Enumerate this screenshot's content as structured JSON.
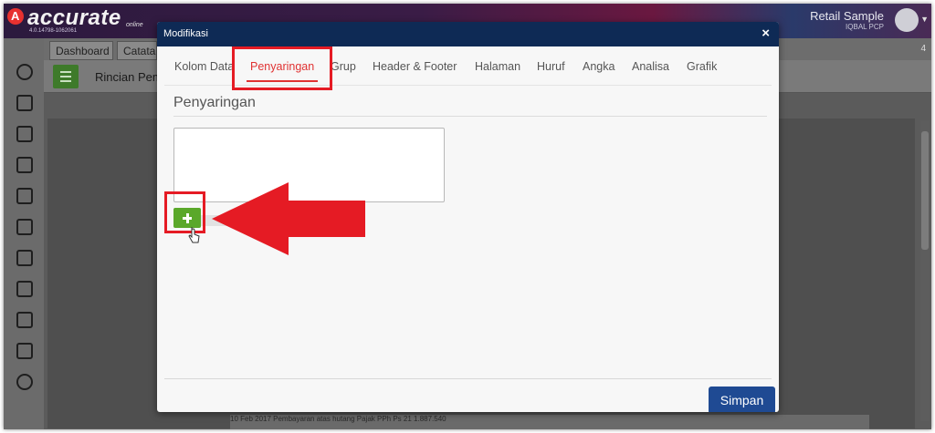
{
  "topbar": {
    "logo_badge": "A",
    "logo_text": "accurate",
    "logo_online": "online",
    "version": "4.0.14798-1062061",
    "user_name": "Retail Sample",
    "user_sub": "IQBAL PCP"
  },
  "background_app": {
    "tabs": [
      {
        "label": "Dashboard"
      },
      {
        "label": "Catata"
      }
    ],
    "tab_count": "4",
    "page_title": "Rincian Pem",
    "row_text": "10 Feb 2017          Pembayaran atas hutang Pajak PPh Ps 21          1.887.540"
  },
  "modal": {
    "title": "Modifikasi",
    "close_label": "×",
    "tabs": [
      {
        "label": "Kolom Data"
      },
      {
        "label": "Penyaringan"
      },
      {
        "label": "Grup"
      },
      {
        "label": "Header & Footer"
      },
      {
        "label": "Halaman"
      },
      {
        "label": "Huruf"
      },
      {
        "label": "Angka"
      },
      {
        "label": "Analisa"
      },
      {
        "label": "Grafik"
      }
    ],
    "active_tab": "Penyaringan",
    "section_title": "Penyaringan",
    "add_label": "+",
    "save_label": "Simpan"
  },
  "colors": {
    "modal_header": "#0e2a55",
    "active_tab": "#e03232",
    "add_button": "#5aa82a",
    "save_button": "#1f4a93",
    "annotation": "#e51b24"
  },
  "icons": [
    "gear-icon",
    "bank-icon",
    "building-icon",
    "ledger-icon",
    "warehouse-icon",
    "tag-icon",
    "cart-icon",
    "purchase-icon",
    "factory-icon",
    "report-icon",
    "settings-circle-icon"
  ]
}
